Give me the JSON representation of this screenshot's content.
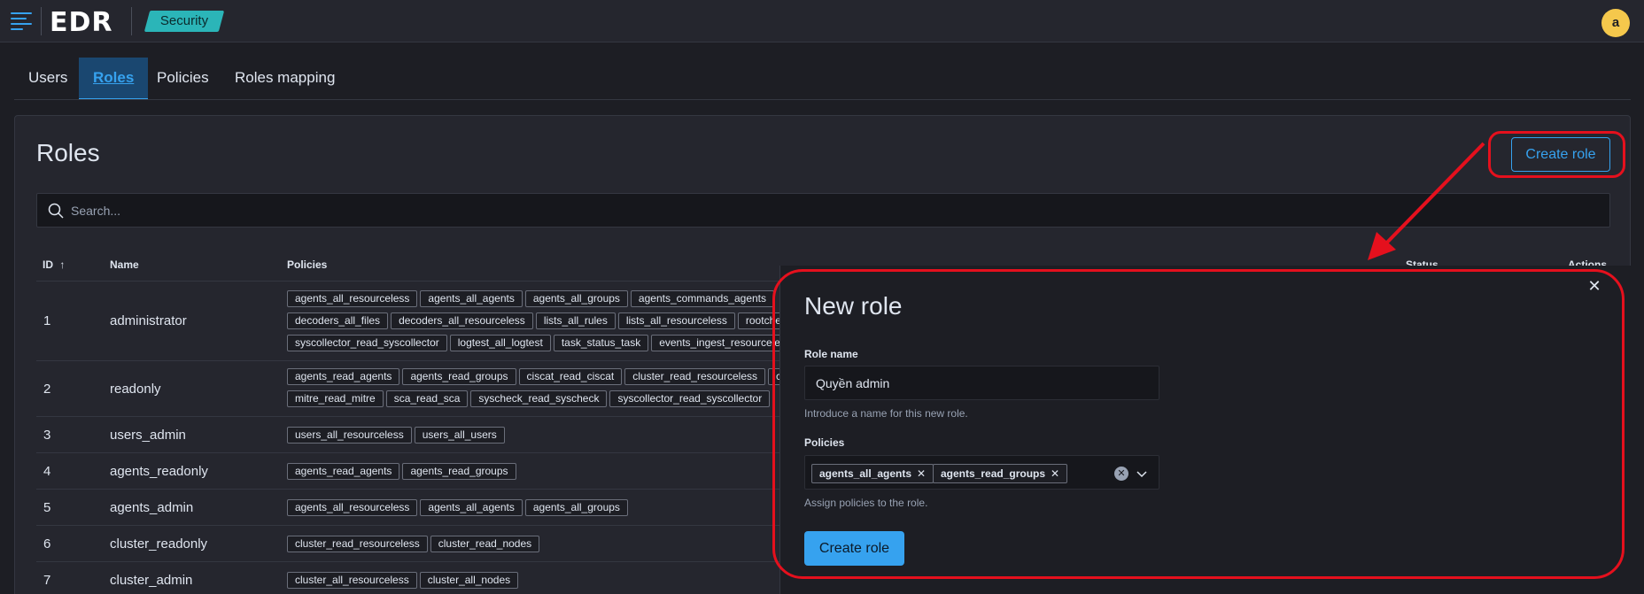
{
  "header": {
    "app_name": "EDR",
    "breadcrumb": "Security",
    "avatar_initial": "a"
  },
  "tabs": [
    {
      "label": "Users",
      "active": false
    },
    {
      "label": "Roles",
      "active": true
    },
    {
      "label": "Policies",
      "active": false
    },
    {
      "label": "Roles mapping",
      "active": false
    }
  ],
  "roles_page": {
    "title": "Roles",
    "create_button": "Create role",
    "search_placeholder": "Search...",
    "columns": {
      "id": "ID",
      "name": "Name",
      "policies": "Policies",
      "status": "Status",
      "actions": "Actions"
    },
    "rows": [
      {
        "id": "1",
        "name": "administrator",
        "policies": [
          "agents_all_resourceless",
          "agents_all_agents",
          "agents_all_groups",
          "agents_commands_agents",
          "decoders_all_files",
          "decoders_all_resourceless",
          "lists_all_rules",
          "lists_all_resourceless",
          "rootcheck",
          "syscollector_read_syscollector",
          "logtest_all_logtest",
          "task_status_task",
          "events_ingest_resourceless"
        ]
      },
      {
        "id": "2",
        "name": "readonly",
        "policies": [
          "agents_read_agents",
          "agents_read_groups",
          "ciscat_read_ciscat",
          "cluster_read_resourceless",
          "c",
          "mitre_read_mitre",
          "sca_read_sca",
          "syscheck_read_syscheck",
          "syscollector_read_syscollector"
        ]
      },
      {
        "id": "3",
        "name": "users_admin",
        "policies": [
          "users_all_resourceless",
          "users_all_users"
        ]
      },
      {
        "id": "4",
        "name": "agents_readonly",
        "policies": [
          "agents_read_agents",
          "agents_read_groups"
        ]
      },
      {
        "id": "5",
        "name": "agents_admin",
        "policies": [
          "agents_all_resourceless",
          "agents_all_agents",
          "agents_all_groups"
        ]
      },
      {
        "id": "6",
        "name": "cluster_readonly",
        "policies": [
          "cluster_read_resourceless",
          "cluster_read_nodes"
        ]
      },
      {
        "id": "7",
        "name": "cluster_admin",
        "policies": [
          "cluster_all_resourceless",
          "cluster_all_nodes"
        ]
      }
    ]
  },
  "new_role_flyout": {
    "title": "New role",
    "role_name_label": "Role name",
    "role_name_value": "Quyền admin",
    "role_name_help": "Introduce a name for this new role.",
    "policies_label": "Policies",
    "selected_policies": [
      "agents_all_agents",
      "agents_read_groups"
    ],
    "policies_help": "Assign policies to the role.",
    "submit_button": "Create role"
  },
  "colors": {
    "accent": "#36a2ef",
    "annotation_red": "#e5101d",
    "breadcrumb_teal": "#2bb5b8"
  }
}
